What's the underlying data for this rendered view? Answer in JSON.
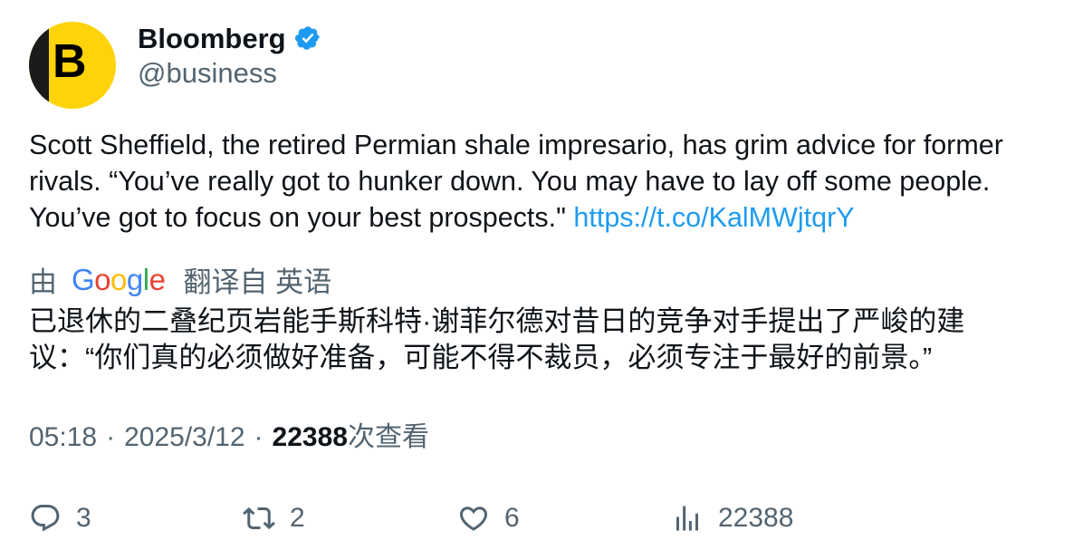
{
  "author": {
    "display_name": "Bloomberg",
    "handle": "@business",
    "avatar_letter": "B",
    "avatar_color": "#ffd30a",
    "verified": true,
    "verified_color": "#1d9bf0"
  },
  "tweet": {
    "text": "Scott Sheffield, the retired Permian shale impresario, has grim advice for former rivals. “You’ve really got to hunker down. You may have to lay off some people. You’ve got to focus on your best prospects.\" ",
    "link": "https://t.co/KalMWjtqrY",
    "link_color": "#1d9bf0"
  },
  "translation": {
    "by_label": "由",
    "provider": [
      "G",
      "o",
      "o",
      "g",
      "l",
      "e"
    ],
    "provider_colors": [
      "#4285f4",
      "#ea4335",
      "#fbbc05",
      "#4285f4",
      "#34a853",
      "#ea4335"
    ],
    "from_label": "翻译自 英语",
    "text": "已退休的二叠纪页岩能手斯科特·谢菲尔德对昔日的竞争对手提出了严峻的建议：“你们真的必须做好准备，可能不得不裁员，必须专注于最好的前景。”"
  },
  "meta": {
    "time": "05:18",
    "separator": "·",
    "date": "2025/3/12",
    "views_count": "22388",
    "views_label": "次查看"
  },
  "actions": {
    "reply": {
      "icon": "reply-icon",
      "count": "3"
    },
    "retweet": {
      "icon": "retweet-icon",
      "count": "2"
    },
    "like": {
      "icon": "heart-icon",
      "count": "6"
    },
    "views": {
      "icon": "analytics-icon",
      "count": "22388"
    }
  },
  "colors": {
    "text_primary": "#0f1419",
    "text_secondary": "#536471"
  }
}
